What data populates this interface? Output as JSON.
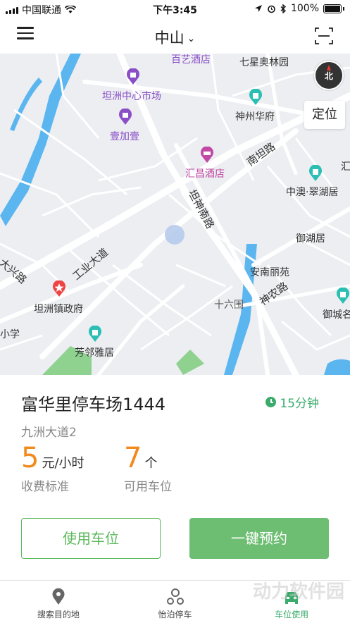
{
  "status_bar": {
    "carrier": "中国联通",
    "time": "下午3:45",
    "battery": "100%"
  },
  "header": {
    "city": "中山",
    "menu_icon": "menu-icon",
    "scan_icon": "scan-icon"
  },
  "map": {
    "compass_label": "北",
    "locate_label": "定位",
    "labels": [
      {
        "text": "百艺酒店",
        "style": "poi-purple"
      },
      {
        "text": "七星奥林园",
        "style": "dark"
      },
      {
        "text": "坦洲中心市场",
        "style": "poi-purple"
      },
      {
        "text": "神州华府",
        "style": "dark"
      },
      {
        "text": "壹加壹",
        "style": "poi-purple"
      },
      {
        "text": "汇昌酒店",
        "style": "poi-pink"
      },
      {
        "text": "南坦路",
        "style": "road"
      },
      {
        "text": "坦神南路",
        "style": "road"
      },
      {
        "text": "中澳·翠湖居",
        "style": "dark"
      },
      {
        "text": "御湖居",
        "style": "dark"
      },
      {
        "text": "工业大道",
        "style": "road"
      },
      {
        "text": "大兴路",
        "style": "road"
      },
      {
        "text": "安南丽苑",
        "style": "dark"
      },
      {
        "text": "坦洲镇政府",
        "style": "dark"
      },
      {
        "text": "十六围",
        "style": "dark"
      },
      {
        "text": "神农路",
        "style": "road"
      },
      {
        "text": "御城名",
        "style": "dark"
      },
      {
        "text": "小学",
        "style": "dark"
      },
      {
        "text": "芳邻雅居",
        "style": "dark"
      },
      {
        "text": "汇",
        "style": "dark"
      }
    ]
  },
  "parking": {
    "name": "富华里停车场1444",
    "duration": "15分钟",
    "address": "九洲大道2",
    "price_value": "5",
    "price_unit": "元/小时",
    "price_caption": "收费标准",
    "spaces_value": "7",
    "spaces_unit": "个",
    "spaces_caption": "可用车位"
  },
  "actions": {
    "use_spot": "使用车位",
    "reserve": "一键预约"
  },
  "tabs": [
    {
      "label": "搜索目的地",
      "icon": "location-pin-icon",
      "active": false
    },
    {
      "label": "怡泊停车",
      "icon": "parking-logo-icon",
      "active": false
    },
    {
      "label": "车位使用",
      "icon": "car-icon",
      "active": true
    }
  ],
  "watermark": "动力软件园",
  "colors": {
    "accent_green": "#3aab6b",
    "button_green": "#6dbd72",
    "number_orange": "#f28a1d"
  }
}
